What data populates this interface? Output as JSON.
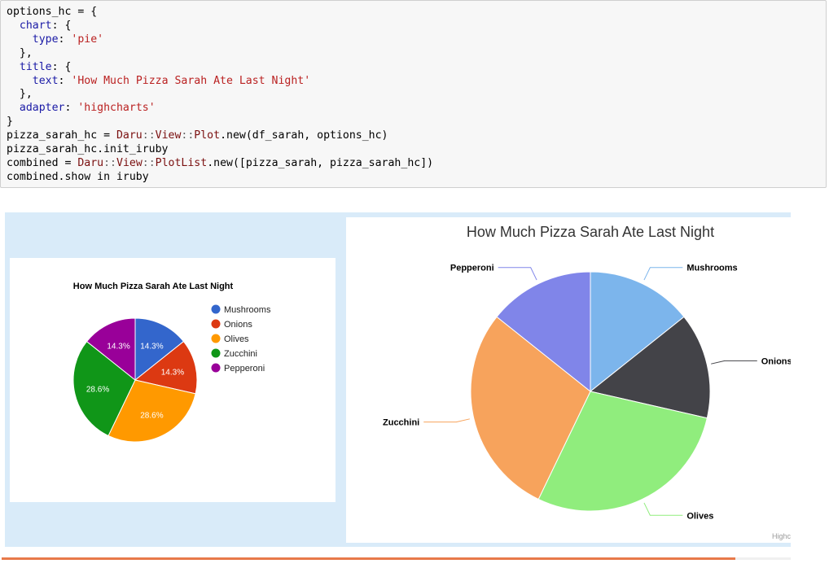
{
  "code_cell": {
    "lines": [
      [
        {
          "t": "options_hc = {",
          "c": ""
        }
      ],
      [
        {
          "t": "  ",
          "c": ""
        },
        {
          "t": "chart",
          "c": "kw"
        },
        {
          "t": ": {",
          "c": ""
        }
      ],
      [
        {
          "t": "    ",
          "c": ""
        },
        {
          "t": "type",
          "c": "kw"
        },
        {
          "t": ": ",
          "c": ""
        },
        {
          "t": "'pie'",
          "c": "str"
        }
      ],
      [
        {
          "t": "  },",
          "c": ""
        }
      ],
      [
        {
          "t": "  ",
          "c": ""
        },
        {
          "t": "title",
          "c": "kw"
        },
        {
          "t": ": {",
          "c": ""
        }
      ],
      [
        {
          "t": "    ",
          "c": ""
        },
        {
          "t": "text",
          "c": "kw"
        },
        {
          "t": ": ",
          "c": ""
        },
        {
          "t": "'How Much Pizza Sarah Ate Last Night'",
          "c": "str"
        }
      ],
      [
        {
          "t": "  },",
          "c": ""
        }
      ],
      [
        {
          "t": "  ",
          "c": ""
        },
        {
          "t": "adapter",
          "c": "kw"
        },
        {
          "t": ": ",
          "c": ""
        },
        {
          "t": "'highcharts'",
          "c": "str"
        }
      ],
      [
        {
          "t": "}",
          "c": ""
        }
      ],
      [
        {
          "t": "pizza_sarah_hc = ",
          "c": ""
        },
        {
          "t": "Daru",
          "c": "cls"
        },
        {
          "t": "::",
          "c": "op"
        },
        {
          "t": "View",
          "c": "cls"
        },
        {
          "t": "::",
          "c": "op"
        },
        {
          "t": "Plot",
          "c": "cls"
        },
        {
          "t": ".new(df_sarah, options_hc)",
          "c": ""
        }
      ],
      [
        {
          "t": "pizza_sarah_hc.init_iruby",
          "c": ""
        }
      ],
      [
        {
          "t": "combined = ",
          "c": ""
        },
        {
          "t": "Daru",
          "c": "cls"
        },
        {
          "t": "::",
          "c": "op"
        },
        {
          "t": "View",
          "c": "cls"
        },
        {
          "t": "::",
          "c": "op"
        },
        {
          "t": "PlotList",
          "c": "cls"
        },
        {
          "t": ".new([pizza_sarah, pizza_sarah_hc])",
          "c": ""
        }
      ],
      [
        {
          "t": "combined.show in iruby",
          "c": ""
        }
      ]
    ]
  },
  "chart_data": [
    {
      "type": "pie",
      "title": "How Much Pizza Sarah Ate Last Night",
      "categories": [
        "Mushrooms",
        "Onions",
        "Olives",
        "Zucchini",
        "Pepperoni"
      ],
      "values": [
        1,
        1,
        2,
        2,
        1
      ],
      "slice_labels": [
        "14.3%",
        "14.3%",
        "28.6%",
        "28.6%",
        "14.3%"
      ],
      "colors": [
        "#3366cc",
        "#dc3912",
        "#ff9900",
        "#109618",
        "#990099"
      ],
      "legend": "right"
    },
    {
      "type": "pie",
      "title": "How Much Pizza Sarah Ate Last Night",
      "categories": [
        "Mushrooms",
        "Onions",
        "Olives",
        "Zucchini",
        "Pepperoni"
      ],
      "values": [
        1,
        1,
        2,
        2,
        1
      ],
      "colors": [
        "#7cb5ec",
        "#434348",
        "#90ed7d",
        "#f7a35c",
        "#8085e9"
      ],
      "credits": "Highc"
    }
  ]
}
